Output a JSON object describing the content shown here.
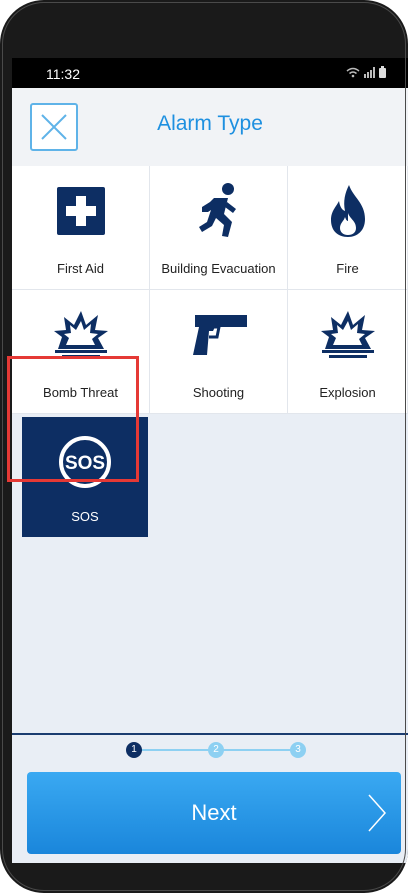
{
  "status_bar": {
    "time": "11:32",
    "icons": "wifi-icon signal-icon battery-icon"
  },
  "header": {
    "title": "Alarm Type",
    "close_icon": "close-icon"
  },
  "alarm_types": [
    {
      "label": "First Aid",
      "icon": "first-aid-icon"
    },
    {
      "label": "Building Evacuation",
      "icon": "running-person-icon"
    },
    {
      "label": "Fire",
      "icon": "fire-icon"
    },
    {
      "label": "Bomb Threat",
      "icon": "bomb-icon"
    },
    {
      "label": "Shooting",
      "icon": "gun-icon"
    },
    {
      "label": "Explosion",
      "icon": "explosion-icon"
    },
    {
      "label": "SOS",
      "icon": "sos-icon",
      "selected": true
    }
  ],
  "stepper": {
    "current_step": 1,
    "steps": [
      "1",
      "2",
      "3"
    ]
  },
  "footer": {
    "next_label": "Next"
  },
  "colors": {
    "accent": "#1e90e0",
    "selected_tile": "#0d2e63",
    "icon": "#0d2e63",
    "selection_outline": "#e53935"
  }
}
